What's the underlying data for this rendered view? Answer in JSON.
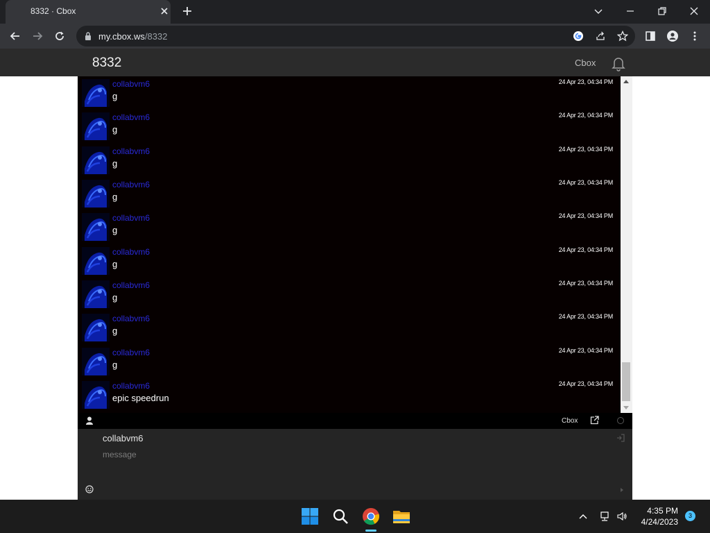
{
  "browser": {
    "tab_title": "8332 · Cbox",
    "url_host": "my.cbox.ws",
    "url_path": "/8332"
  },
  "site": {
    "title": "8332",
    "nav_link": "Cbox"
  },
  "messages": [
    {
      "name": "collabvm6",
      "time": "24 Apr 23, 04:34 PM",
      "text": "g"
    },
    {
      "name": "collabvm6",
      "time": "24 Apr 23, 04:34 PM",
      "text": "g"
    },
    {
      "name": "collabvm6",
      "time": "24 Apr 23, 04:34 PM",
      "text": "g"
    },
    {
      "name": "collabvm6",
      "time": "24 Apr 23, 04:34 PM",
      "text": "g"
    },
    {
      "name": "collabvm6",
      "time": "24 Apr 23, 04:34 PM",
      "text": "g"
    },
    {
      "name": "collabvm6",
      "time": "24 Apr 23, 04:34 PM",
      "text": "g"
    },
    {
      "name": "collabvm6",
      "time": "24 Apr 23, 04:34 PM",
      "text": "g"
    },
    {
      "name": "collabvm6",
      "time": "24 Apr 23, 04:34 PM",
      "text": "g"
    },
    {
      "name": "collabvm6",
      "time": "24 Apr 23, 04:34 PM",
      "text": "g"
    },
    {
      "name": "collabvm6",
      "time": "24 Apr 23, 04:34 PM",
      "text": "epic speedrun"
    }
  ],
  "cbox_bar": {
    "brand": "Cbox"
  },
  "compose": {
    "username": "collabvm6",
    "message_placeholder": "message"
  },
  "taskbar": {
    "time": "4:35 PM",
    "date": "4/24/2023",
    "notification_count": "3"
  },
  "colors": {
    "username": "#2a2ad8",
    "chat_background": "#060000",
    "header_background": "#2b2b2b",
    "compose_background": "#252525"
  },
  "icons": [
    "lock-icon",
    "google-icon",
    "share-icon",
    "star-icon",
    "side-panel-icon",
    "profile-icon",
    "menu-icon",
    "bell-icon",
    "user-icon",
    "popout-icon",
    "logout-icon",
    "smiley-icon",
    "windows-start-icon",
    "search-icon",
    "chrome-icon",
    "file-explorer-icon",
    "chevron-up-icon",
    "network-icon",
    "volume-icon"
  ]
}
